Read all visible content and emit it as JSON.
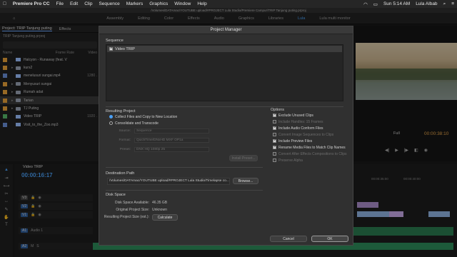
{
  "menubar": {
    "app": "Premiere Pro CC",
    "items": [
      "File",
      "Edit",
      "Clip",
      "Sequence",
      "Markers",
      "Graphics",
      "Window",
      "Help"
    ],
    "right": [
      "Sun 5:14 AM",
      "Lula Albab"
    ]
  },
  "path": "/Volumes/DATAmac/YOUTUBE upload/#PROJECT Lula Studio/Premiere Campur/TRIP Tanjung puting.prproj",
  "workspaces": {
    "tabs": [
      "Assembly",
      "Editing",
      "Color",
      "Effects",
      "Audio",
      "Graphics",
      "Libraries",
      "Lula",
      "Lula multi monitor"
    ],
    "active": "Lula"
  },
  "project_panel": {
    "tabs": [
      "Project: TRIP Tanjung puting",
      "Effects"
    ],
    "project_file": "TRIP Tanjung puting.prproj",
    "columns": [
      "Name",
      "Frame Rate",
      "Video"
    ],
    "items": [
      {
        "name": "Halcyon - Runaway (feat. V",
        "color": "#e8a23a",
        "type": "clip",
        "value": ""
      },
      {
        "name": "kurs2",
        "color": "#e8a23a",
        "type": "folder",
        "value": ""
      },
      {
        "name": "menelusuri sungai.mp4",
        "color": "#6a8fd8",
        "type": "clip",
        "value": "1280 ."
      },
      {
        "name": "Menyusuri sungai",
        "color": "#e8a23a",
        "type": "folder",
        "value": ""
      },
      {
        "name": "Rumah adat",
        "color": "#e8a23a",
        "type": "folder",
        "value": ""
      },
      {
        "name": "Tarian",
        "color": "#e8a23a",
        "type": "folder",
        "value": ""
      },
      {
        "name": "TJ Puting",
        "color": "#e8a23a",
        "type": "folder",
        "value": ""
      },
      {
        "name": "Video TRIP",
        "color": "#57b86a",
        "type": "clip",
        "value": "1920 ."
      },
      {
        "name": "Visit_to_the_Zoo.mp3",
        "color": "#6a8fd8",
        "type": "clip",
        "value": ""
      }
    ]
  },
  "program_monitor": {
    "fit": "Full",
    "timecode": "00:00:38:10"
  },
  "timeline": {
    "sequence_tab": "Video TRIP",
    "timecode": "00:00:16:17",
    "ruler": [
      "00:00:35:00",
      "00:00:40:00"
    ],
    "tracks": [
      "V3",
      "V2",
      "V1",
      "A1",
      "A2"
    ],
    "audio_label": "Audio 1"
  },
  "dialog": {
    "title": "Project Manager",
    "sequence_label": "Sequence",
    "sequence_item": "Video TRIP",
    "resulting_project_label": "Resulting Project",
    "radio_collect": "Collect Files and Copy to New Location",
    "radio_consolidate": "Consolidate and Transcode",
    "fields": [
      {
        "key": "Source:",
        "value": "Sequence"
      },
      {
        "key": "Format:",
        "value": "QuickTime/DNxHD MXF OP1a"
      },
      {
        "key": "Preset:",
        "value": "DNX HQ 1080p 25"
      }
    ],
    "install_preset": "Install Preset...",
    "options_label": "Options",
    "options": [
      {
        "label": "Exclude Unused Clips",
        "checked": true,
        "enabled": true
      },
      {
        "label": "Include Handles: 15 Frames",
        "checked": false,
        "enabled": false
      },
      {
        "label": "Include Audio Conform Files",
        "checked": true,
        "enabled": true
      },
      {
        "label": "Convert Image Sequences to Clips",
        "checked": false,
        "enabled": false
      },
      {
        "label": "Include Preview Files",
        "checked": true,
        "enabled": true
      },
      {
        "label": "Rename Media Files to Match Clip Names",
        "checked": true,
        "enabled": true
      },
      {
        "label": "Convert After Effects Compositions to Clips",
        "checked": false,
        "enabled": false
      },
      {
        "label": "Preserve Alpha",
        "checked": false,
        "enabled": false
      }
    ],
    "destination_label": "Destination Path",
    "destination_value": "/Volumes/DATAmac/YOUTUBE upload/#PROJECT Lula Studio/Timelapse co...",
    "browse": "Browse...",
    "disk_space_label": "Disk Space",
    "disk_available_key": "Disk Space Available:",
    "disk_available_val": "46.35 GB",
    "original_size_key": "Original Project Size:",
    "original_size_val": "Unknown",
    "resulting_size_key": "Resulting Project Size (est.):",
    "calculate": "Calculate",
    "cancel": "Cancel",
    "ok": "OK"
  }
}
